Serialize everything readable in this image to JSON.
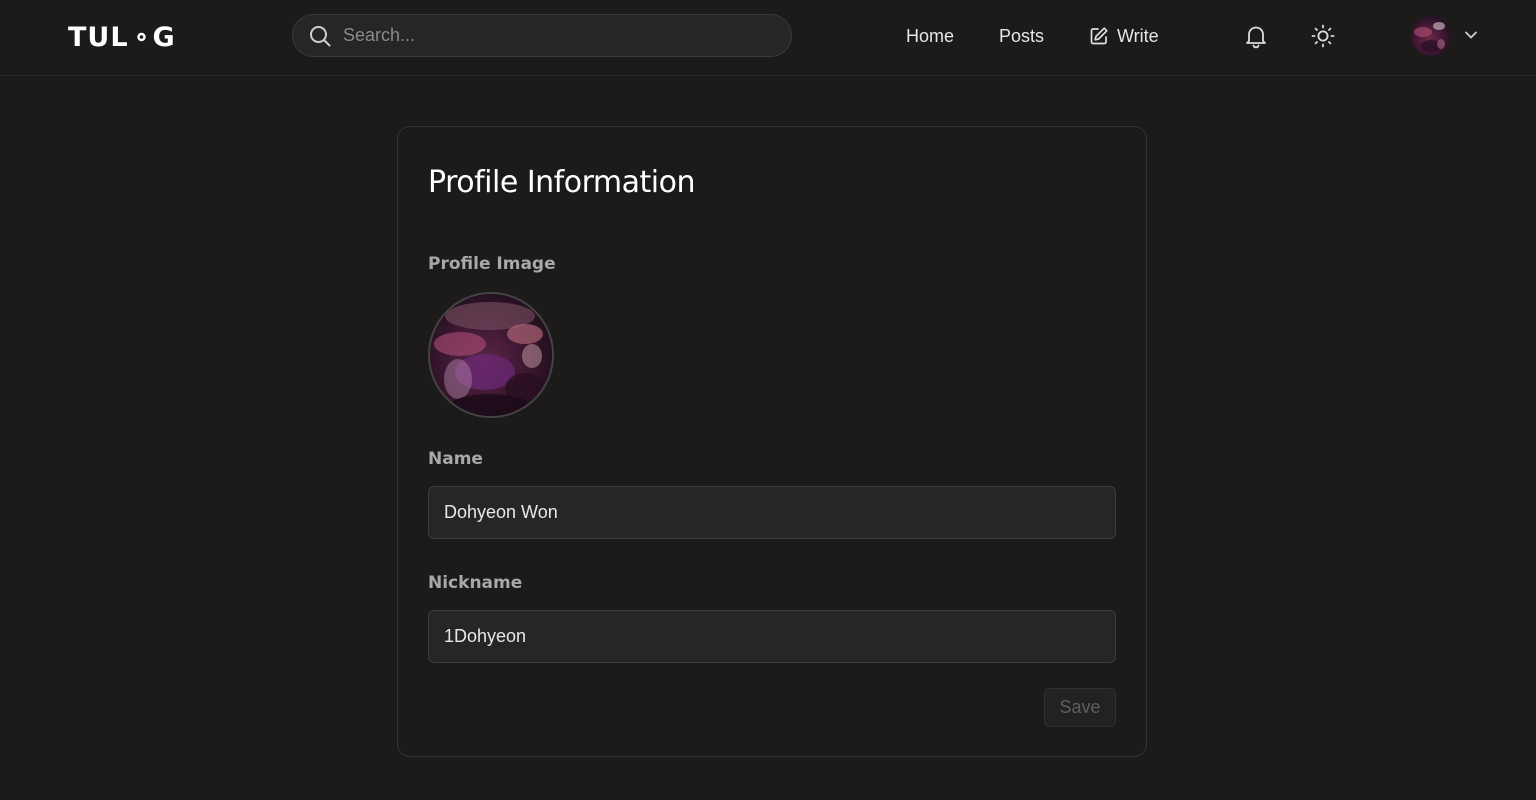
{
  "header": {
    "logo_text": "TULOG",
    "search": {
      "placeholder": "Search...",
      "value": ""
    },
    "nav": [
      {
        "label": "Home"
      },
      {
        "label": "Posts"
      },
      {
        "label": "Write",
        "icon": "edit-icon"
      }
    ],
    "icons": [
      "bell-icon",
      "sun-icon",
      "avatar",
      "chevron-down-icon"
    ]
  },
  "profile": {
    "title": "Profile Information",
    "image_label": "Profile Image",
    "name_label": "Name",
    "name_value": "Dohyeon Won",
    "nickname_label": "Nickname",
    "nickname_value": "1Dohyeon",
    "save_label": "Save"
  },
  "colors": {
    "background": "#1c1b1a",
    "logo_accent": "#7c4dff",
    "field_bg": "#262626"
  }
}
